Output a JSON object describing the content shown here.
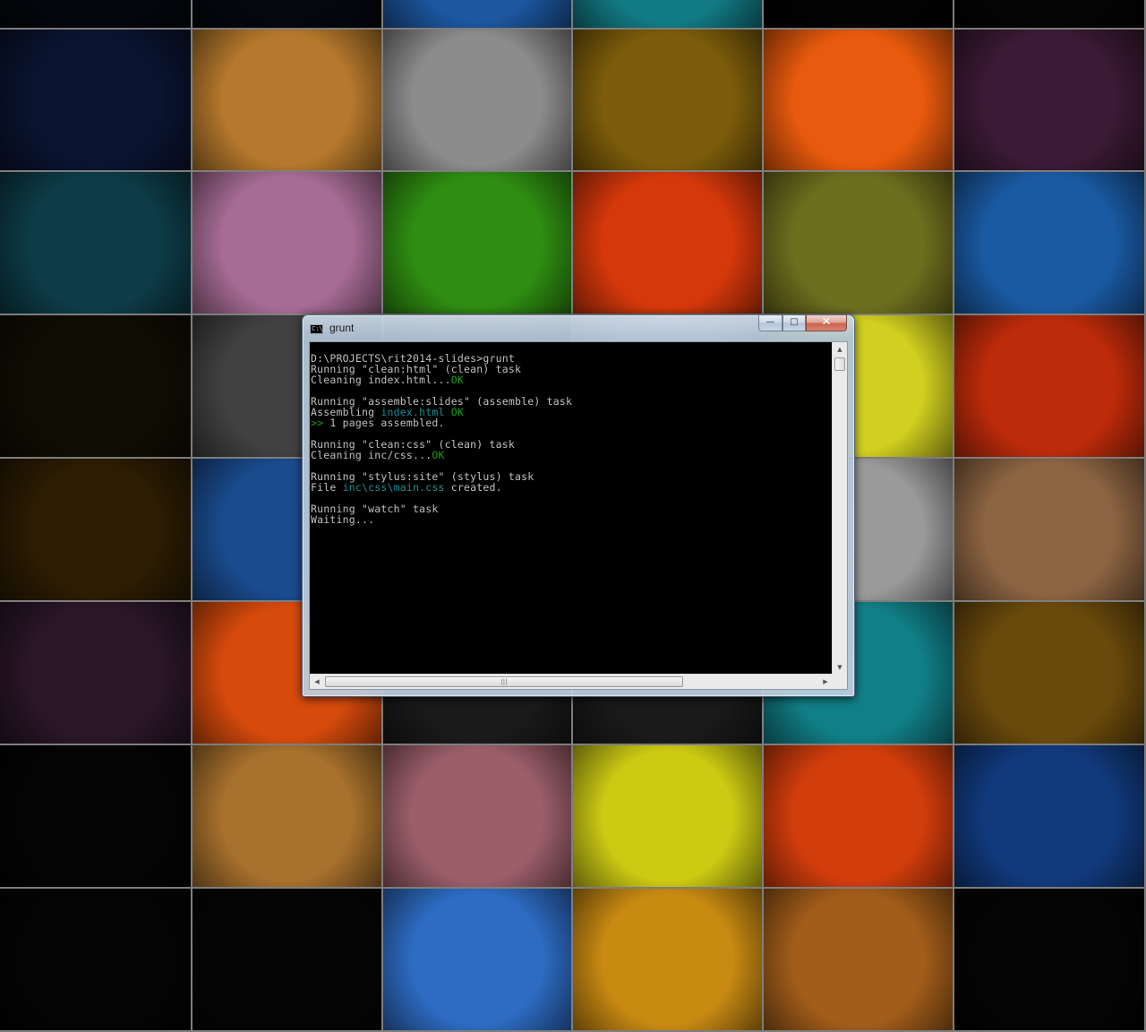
{
  "desktop": {
    "wallpaper_tiles": [
      [
        "#04060c",
        "#05070e",
        "#1c57a0",
        "#127c86",
        "#030303",
        "#040404"
      ],
      [
        "#0a1430",
        "#b5782c",
        "#8c8c8c",
        "#7d5d0b",
        "#e85a0d",
        "#3b1a35"
      ],
      [
        "#0d3c48",
        "#a76c95",
        "#2f8d12",
        "#d5380b",
        "#6e6e1f",
        "#1a5aa3"
      ],
      [
        "#100d02",
        "#414141",
        "#5f5a4a",
        "#c9b4b8",
        "#d1cf1f",
        "#bd2b0a"
      ],
      [
        "#2b1c02",
        "#1a4b8e",
        "#1a1a1a",
        "#1a1a1a",
        "#9a9a9a",
        "#8c6442"
      ],
      [
        "#2a1628",
        "#d64a0c",
        "#1a1a1a",
        "#1a1a1a",
        "#117f87",
        "#6a4a0c"
      ],
      [
        "#040404",
        "#a8712d",
        "#9c5f6a",
        "#cdca13",
        "#d23d0c",
        "#113a7d"
      ],
      [
        "#040404",
        "#050505",
        "#2e6cc4",
        "#c98a12",
        "#a35d1a",
        "#040404"
      ]
    ]
  },
  "console": {
    "title": "grunt",
    "icon": "C:\\",
    "controls": {
      "minimize": "—",
      "maximize": "□",
      "close": "✕"
    },
    "lines": [
      [
        {
          "t": "D:\\PROJECTS\\rit2014-slides>grunt",
          "c": ""
        }
      ],
      [
        {
          "t": "Running \"clean:html\" (clean) task",
          "c": ""
        }
      ],
      [
        {
          "t": "Cleaning index.html...",
          "c": ""
        },
        {
          "t": "OK",
          "c": "ok"
        }
      ],
      [],
      [
        {
          "t": "Running \"assemble:slides\" (assemble) task",
          "c": ""
        }
      ],
      [
        {
          "t": "Assembling ",
          "c": ""
        },
        {
          "t": "index.html",
          "c": "cy"
        },
        {
          "t": " OK",
          "c": "ok"
        }
      ],
      [
        {
          "t": ">>",
          "c": "ok"
        },
        {
          "t": " 1 pages assembled.",
          "c": ""
        }
      ],
      [],
      [
        {
          "t": "Running \"clean:css\" (clean) task",
          "c": ""
        }
      ],
      [
        {
          "t": "Cleaning inc/css...",
          "c": ""
        },
        {
          "t": "OK",
          "c": "ok"
        }
      ],
      [],
      [
        {
          "t": "Running \"stylus:site\" (stylus) task",
          "c": ""
        }
      ],
      [
        {
          "t": "File ",
          "c": ""
        },
        {
          "t": "inc\\css\\main.css",
          "c": "cy"
        },
        {
          "t": " created.",
          "c": ""
        }
      ],
      [],
      [
        {
          "t": "Running \"watch\" task",
          "c": ""
        }
      ],
      [
        {
          "t": "Waiting...",
          "c": ""
        }
      ]
    ],
    "scroll_thumb_grip": "|||",
    "colors": {
      "text": "#c0c0c0",
      "ok": "#16a116",
      "path": "#1a8f95",
      "background": "#000000"
    }
  }
}
